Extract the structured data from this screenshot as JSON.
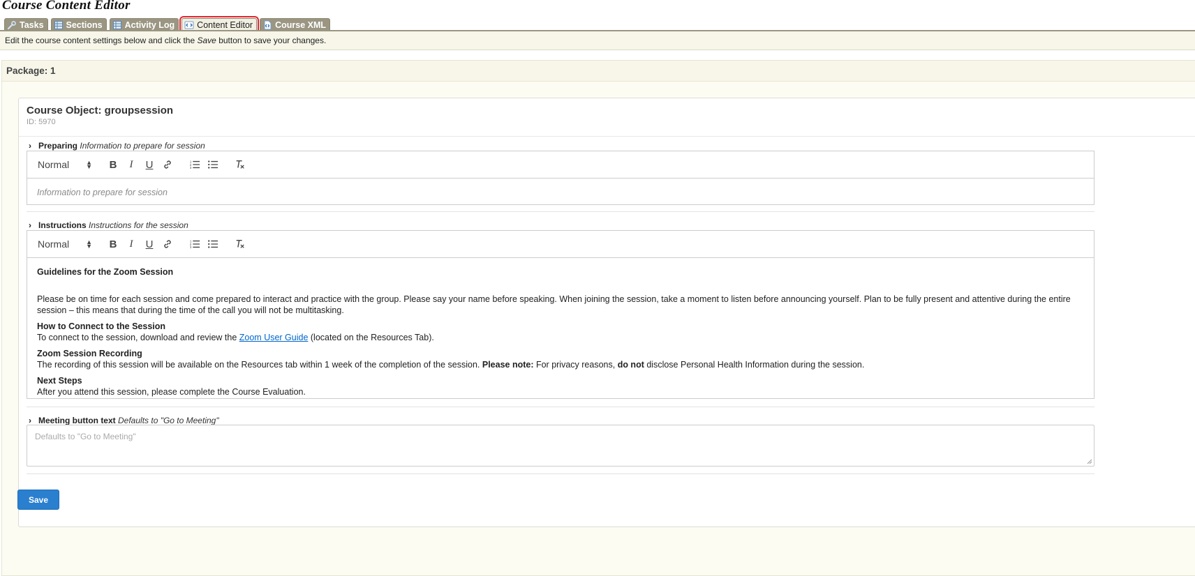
{
  "app": {
    "title": "Course Content Editor"
  },
  "tabs": [
    {
      "label": "Tasks",
      "icon": "wrench-icon"
    },
    {
      "label": "Sections",
      "icon": "grid-icon"
    },
    {
      "label": "Activity Log",
      "icon": "grid-icon"
    },
    {
      "label": "Content Editor",
      "icon": "code-icon",
      "active": true
    },
    {
      "label": "Course XML",
      "icon": "xml-file-icon"
    }
  ],
  "info": {
    "prefix": "Edit the course content settings below and click the ",
    "save_word": "Save",
    "suffix": " button to save your changes."
  },
  "package": {
    "title": "Package: 1"
  },
  "course_object": {
    "title": "Course Object: groupsession",
    "id": "ID: 5970"
  },
  "toolbar": {
    "format_value": "Normal"
  },
  "fields": {
    "preparing": {
      "label": "Preparing",
      "hint": "Information to prepare for session",
      "placeholder": "Information to prepare for session"
    },
    "instructions": {
      "label": "Instructions",
      "hint": "Instructions for the session",
      "heading1": "Guidelines for the Zoom Session",
      "para1": "Please be on time for each session and come prepared to interact and practice with the group. Please say your name before speaking. When joining the session, take a moment to listen before announcing yourself. Plan to be fully present and attentive during the entire session – this means that during the time of the call you will not be multitasking.",
      "heading2": "How to Connect to the Session",
      "para2_prefix": "To connect to the session, download and review the ",
      "para2_link": "Zoom User Guide",
      "para2_suffix": " (located on the Resources Tab).",
      "heading3": "Zoom Session Recording",
      "para3_a": "The recording of this session will be available on the Resources tab within 1 week of the completion of the session. ",
      "para3_b": "Please note:",
      "para3_c": " For privacy reasons, ",
      "para3_d": "do not",
      "para3_e": " disclose Personal Health Information during the session.",
      "heading4": "Next Steps",
      "para4": "After you attend this session, please complete the Course Evaluation."
    },
    "meeting_button": {
      "label": "Meeting button text",
      "hint": "Defaults to \"Go to Meeting\"",
      "placeholder": "Defaults to \"Go to Meeting\""
    }
  },
  "actions": {
    "save_label": "Save"
  },
  "colors": {
    "accent": "#2a7fcf",
    "tab_bg": "#9a9682",
    "highlight": "#e0262e"
  }
}
